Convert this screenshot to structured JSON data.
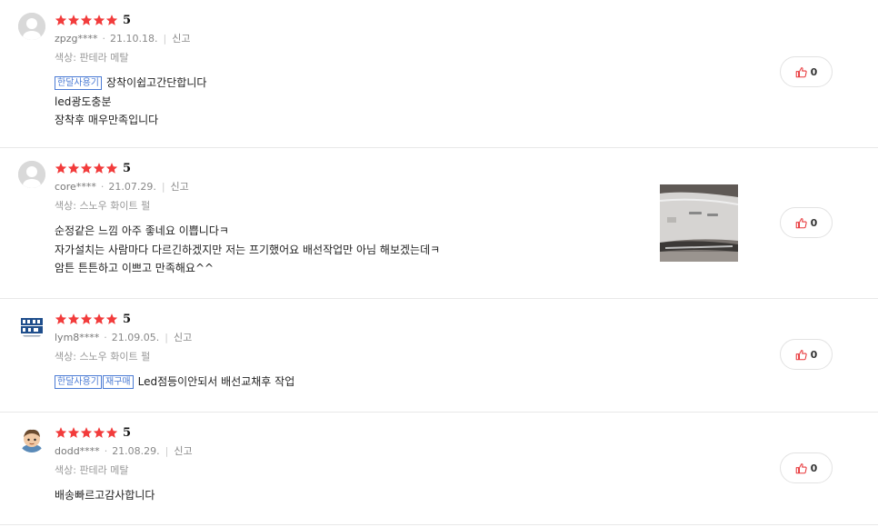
{
  "colors": {
    "star": "#f23b3b",
    "badge": "#4b7bd4",
    "like_icon": "#e8393c"
  },
  "reviews": [
    {
      "rating": "5",
      "stars_filled": 5,
      "user": "zpzg****",
      "date": "21.10.18.",
      "report": "신고",
      "option": "색상: 판테라 메탈",
      "badges": [
        "한달사용기"
      ],
      "lines": [
        "장착이쉽고간단합니다",
        "led광도충분",
        "장착후 매우만족입니다"
      ],
      "likes": "0",
      "avatar": "default-avatar-icon"
    },
    {
      "rating": "5",
      "stars_filled": 5,
      "user": "core****",
      "date": "21.07.29.",
      "report": "신고",
      "option": "색상: 스노우 화이트 펄",
      "badges": [],
      "lines": [
        "순정같은 느낌 아주 좋네요 이쁩니다ㅋ",
        "자가설치는 사람마다 다르긴하겠지만 저는 프기했어요 배선작업만 아님 해보겠는데ㅋ",
        "암튼 튼튼하고 이쁘고 만족해요^^"
      ],
      "likes": "0",
      "avatar": "default-avatar-icon"
    },
    {
      "rating": "5",
      "stars_filled": 5,
      "user": "lym8****",
      "date": "21.09.05.",
      "report": "신고",
      "option": "색상: 스노우 화이트 펄",
      "badges": [
        "한달사용기",
        "재구매"
      ],
      "lines": [
        "Led점등이안되서 배선교채후 작업"
      ],
      "likes": "0",
      "avatar": "logo-avatar-icon"
    },
    {
      "rating": "5",
      "stars_filled": 5,
      "user": "dodd****",
      "date": "21.08.29.",
      "report": "신고",
      "option": "색상: 판테라 메탈",
      "badges": [],
      "lines": [
        "배송빠르고감사합니다"
      ],
      "likes": "0",
      "avatar": "character-avatar-icon"
    }
  ]
}
